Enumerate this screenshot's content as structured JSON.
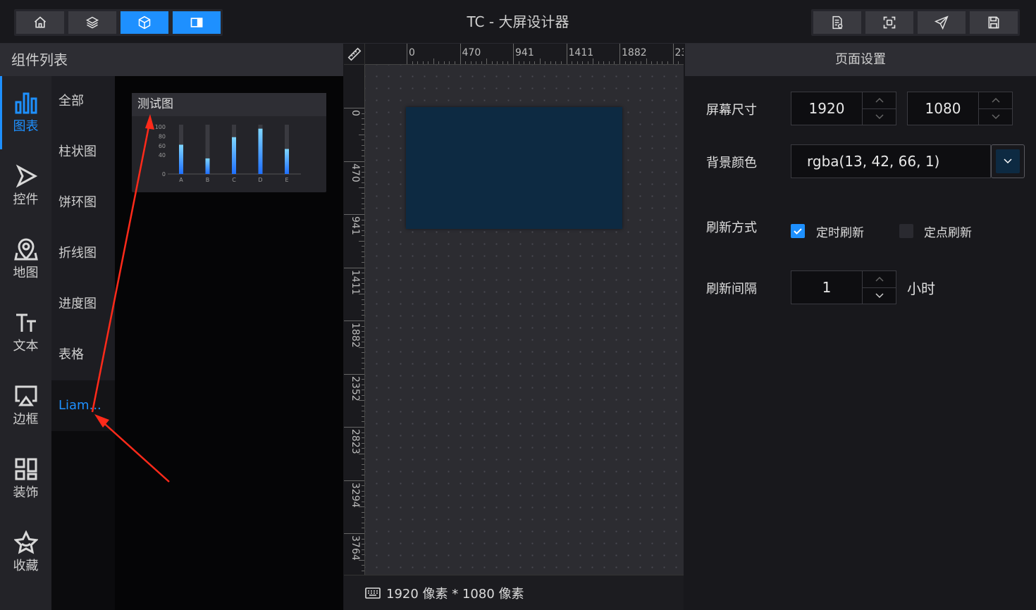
{
  "app": {
    "title": "TC - 大屏设计器"
  },
  "toolbar": {
    "left": [
      {
        "icon": "home-icon",
        "active": false
      },
      {
        "icon": "layers-icon",
        "active": false
      },
      {
        "icon": "cube-icon",
        "active": true
      },
      {
        "icon": "panel-icon",
        "active": true
      }
    ],
    "right": [
      {
        "icon": "document-icon"
      },
      {
        "icon": "screenshot-icon"
      },
      {
        "icon": "send-icon"
      },
      {
        "icon": "save-icon"
      }
    ]
  },
  "left_panel": {
    "title": "组件列表",
    "categories": [
      {
        "label": "图表",
        "icon": "bar-chart-icon",
        "active": true
      },
      {
        "label": "控件",
        "icon": "play-icon",
        "active": false
      },
      {
        "label": "地图",
        "icon": "map-pin-icon",
        "active": false
      },
      {
        "label": "文本",
        "icon": "text-icon",
        "active": false
      },
      {
        "label": "边框",
        "icon": "airplay-icon",
        "active": false
      },
      {
        "label": "装饰",
        "icon": "grid-icon",
        "active": false
      },
      {
        "label": "收藏",
        "icon": "star-icon",
        "active": false
      }
    ],
    "subcategories": [
      "全部",
      "柱状图",
      "饼环图",
      "折线图",
      "进度图",
      "表格",
      "Liam..."
    ],
    "active_subcategory": "Liam...",
    "component_card": {
      "title": "测试图",
      "preview": {
        "categories": [
          "A",
          "B",
          "C",
          "D",
          "E"
        ],
        "values": [
          62,
          33,
          78,
          96,
          53
        ],
        "y_ticks": [
          "100",
          "80",
          "60",
          "40",
          "0"
        ]
      }
    }
  },
  "rulers": {
    "horizontal": [
      "0",
      "470",
      "941",
      "1411",
      "1882",
      "23"
    ],
    "vertical": [
      "0",
      "470",
      "941",
      "1411",
      "1882",
      "2352",
      "2823",
      "3294",
      "3764"
    ]
  },
  "canvas": {
    "screen_color": "#0d2a42"
  },
  "status_bar": {
    "text": "1920 像素 * 1080 像素"
  },
  "page_settings": {
    "title": "页面设置",
    "screen_size_label": "屏幕尺寸",
    "width": "1920",
    "height": "1080",
    "bg_color_label": "背景颜色",
    "bg_color": "rgba(13, 42, 66, 1)",
    "refresh_mode_label": "刷新方式",
    "refresh_timed": "定时刷新",
    "refresh_timed_checked": true,
    "refresh_point": "定点刷新",
    "refresh_point_checked": false,
    "refresh_interval_label": "刷新间隔",
    "refresh_interval": "1",
    "refresh_unit": "小时"
  },
  "colors": {
    "accent": "#1e90ff",
    "panel": "#2d2d33",
    "annotation": "#ff2a1a"
  }
}
